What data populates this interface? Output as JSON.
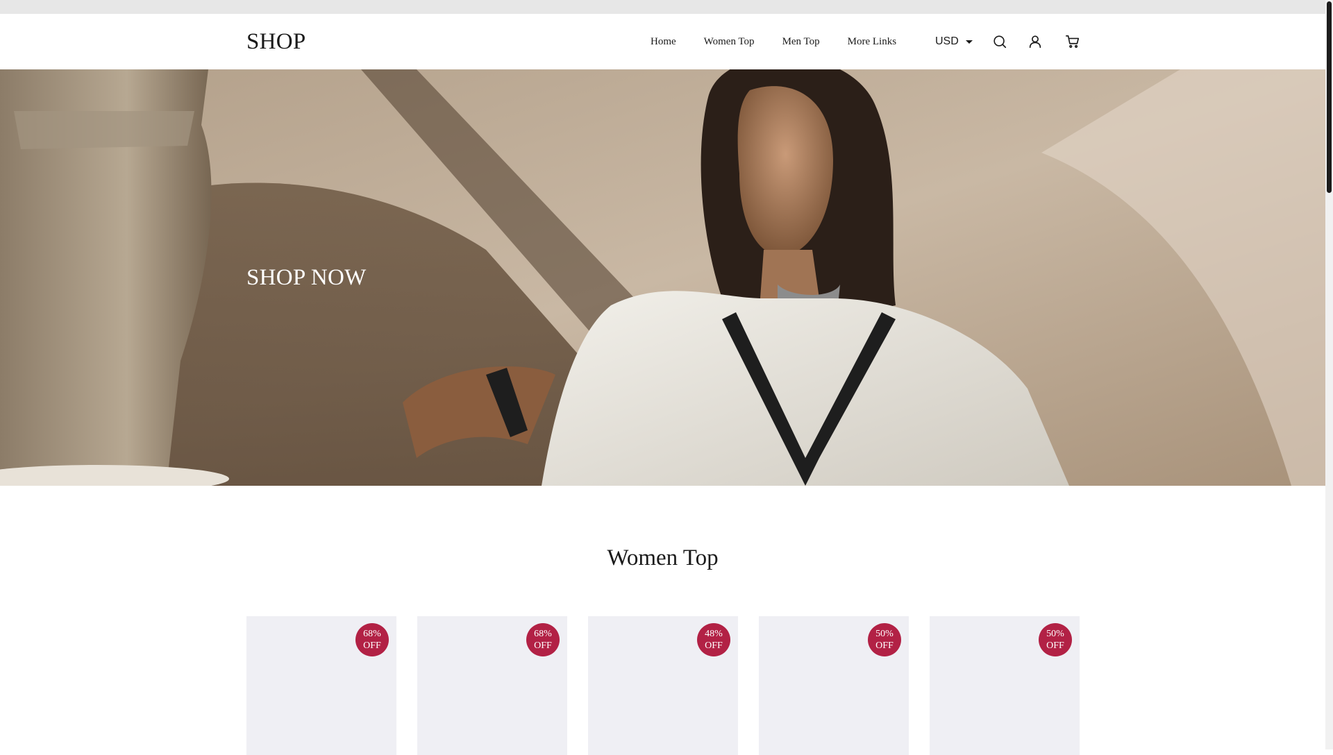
{
  "header": {
    "logo": "SHOP",
    "nav": [
      {
        "label": "Home"
      },
      {
        "label": "Women Top"
      },
      {
        "label": "Men Top"
      },
      {
        "label": "More Links"
      }
    ],
    "currency": "USD",
    "icons": [
      "search-icon",
      "user-icon",
      "cart-icon"
    ]
  },
  "hero": {
    "cta": "SHOP NOW"
  },
  "section": {
    "title": "Women Top"
  },
  "products": [
    {
      "discount": "68%",
      "discount_suffix": "OFF"
    },
    {
      "discount": "68%",
      "discount_suffix": "OFF"
    },
    {
      "discount": "48%",
      "discount_suffix": "OFF"
    },
    {
      "discount": "50%",
      "discount_suffix": "OFF"
    },
    {
      "discount": "50%",
      "discount_suffix": "OFF"
    }
  ],
  "colors": {
    "badge": "#b22145",
    "card_bg": "#efeff4",
    "text": "#1a1a1a"
  }
}
